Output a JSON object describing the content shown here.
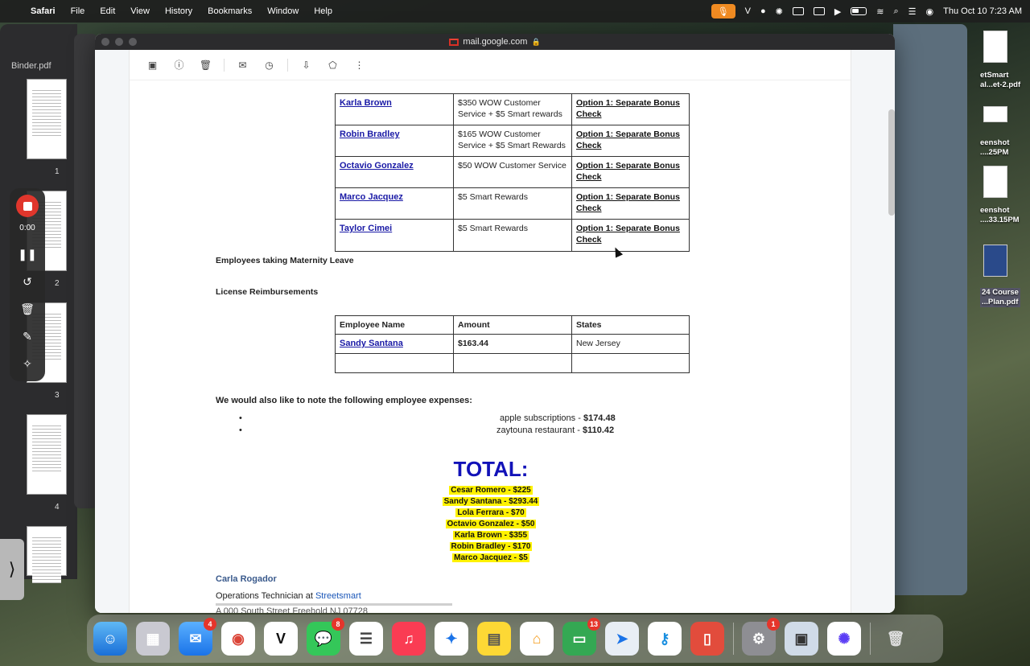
{
  "menubar": {
    "app": "Safari",
    "items": [
      "File",
      "Edit",
      "View",
      "History",
      "Bookmarks",
      "Window",
      "Help"
    ],
    "clock": "Thu Oct 10  7:23 AM"
  },
  "background": {
    "left_window_title": "Binder.pdf",
    "page_numbers": [
      "1",
      "2",
      "3",
      "4"
    ],
    "desktop_files": [
      "etSmart\nal...et-2.pdf",
      "eenshot\n....25PM",
      "eenshot\n....33.15PM",
      "24 Course\n...Plan.pdf"
    ]
  },
  "recorder": {
    "time": "0:00"
  },
  "browser": {
    "url": "mail.google.com"
  },
  "email": {
    "bonus_rows": [
      {
        "name": "Karla Brown",
        "amount": "$350 WOW Customer Service + $5 Smart rewards",
        "option": "Option 1: Separate Bonus Check"
      },
      {
        "name": "Robin Bradley",
        "amount": "$165 WOW Customer Service + $5 Smart Rewards",
        "option": "Option 1: Separate Bonus Check"
      },
      {
        "name": "Octavio Gonzalez",
        "amount": "$50 WOW Customer Service",
        "option": "Option 1: Separate Bonus Check"
      },
      {
        "name": "Marco Jacquez",
        "amount": "$5 Smart Rewards",
        "option": "Option 1: Separate Bonus Check"
      },
      {
        "name": "Taylor Cimei",
        "amount": "$5 Smart Rewards",
        "option": "Option 1: Separate Bonus Check"
      }
    ],
    "maternity_heading": "Employees taking Maternity Leave",
    "license_heading": "License Reimbursements",
    "license_table": {
      "headers": [
        "Employee Name",
        "Amount",
        "States"
      ],
      "row": {
        "name": "Sandy Santana",
        "amount": "$163.44",
        "state": "New Jersey"
      }
    },
    "expenses_heading": "We would also like to note the following employee expenses:",
    "expenses": [
      {
        "label": "apple subscriptions - ",
        "amount": "$174.48"
      },
      {
        "label": "zaytouna restaurant - ",
        "amount": "$110.42"
      }
    ],
    "total_title": "TOTAL:",
    "totals": [
      "Cesar Romero - $225",
      "Sandy Santana - $293.44",
      "Lola Ferrara - $70",
      "Octavio Gonzalez - $50",
      "Karla Brown - $355",
      "Robin Bradley - $170",
      "Marco Jacquez - $5"
    ],
    "signature": {
      "name": "Carla Rogador",
      "role_prefix": "Operations Technician at ",
      "company": "Streetsmart",
      "address": "A 000 South Street Freehold NJ 07728"
    }
  },
  "dock": {
    "mail_badge": "4",
    "messages_badge": "8",
    "chat_badge": "13",
    "settings_badge": "1"
  }
}
